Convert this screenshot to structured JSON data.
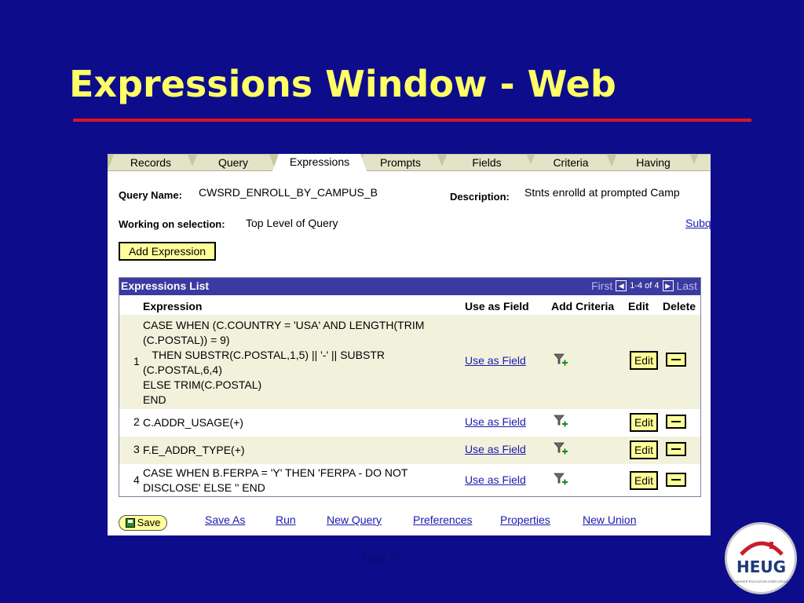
{
  "slide": {
    "title": "Expressions Window - Web",
    "page_number": "Page 15",
    "logo": {
      "text": "HEUG",
      "subtext": "HIGHER EDUCATION USER GROUP"
    }
  },
  "tabs": [
    "Records",
    "Query",
    "Expressions",
    "Prompts",
    "Fields",
    "Criteria",
    "Having"
  ],
  "active_tab": "Expressions",
  "query": {
    "name_label": "Query Name:",
    "name_value": "CWSRD_ENROLL_BY_CAMPUS_B",
    "description_label": "Description:",
    "description_value": "Stnts enrolld at prompted Camp",
    "selection_label": "Working on selection:",
    "selection_value": "Top Level of Query",
    "subquery_link": "Subq"
  },
  "add_expression_label": "Add Expression",
  "grid": {
    "title": "Expressions List",
    "nav_first": "First",
    "nav_count": "1-4 of 4",
    "nav_last": "Last",
    "columns": [
      "Expression",
      "Use as Field",
      "Add Criteria",
      "Edit",
      "Delete"
    ],
    "rows": [
      {
        "num": "1",
        "expression": "CASE WHEN (C.COUNTRY = 'USA' AND LENGTH(TRIM\n(C.POSTAL)) = 9)\n   THEN SUBSTR(C.POSTAL,1,5) || '-' || SUBSTR\n(C.POSTAL,6,4)\nELSE TRIM(C.POSTAL)\nEND",
        "use_as_field": "Use as Field",
        "edit": "Edit"
      },
      {
        "num": "2",
        "expression": "C.ADDR_USAGE(+)",
        "use_as_field": "Use as Field",
        "edit": "Edit"
      },
      {
        "num": "3",
        "expression": "F.E_ADDR_TYPE(+)",
        "use_as_field": "Use as Field",
        "edit": "Edit"
      },
      {
        "num": "4",
        "expression": "CASE WHEN B.FERPA = 'Y' THEN 'FERPA - DO NOT\nDISCLOSE' ELSE '' END",
        "use_as_field": "Use as Field",
        "edit": "Edit"
      }
    ]
  },
  "footer": {
    "save": "Save",
    "links": [
      "Save As",
      "Run",
      "New Query",
      "Preferences",
      "Properties",
      "New Union"
    ]
  },
  "colors": {
    "background": "#0d0d8c",
    "title": "#ffff66",
    "rule": "#e0141e",
    "grid_header": "#3a3aa0",
    "button": "#ffff99",
    "link": "#1a1ab0"
  }
}
